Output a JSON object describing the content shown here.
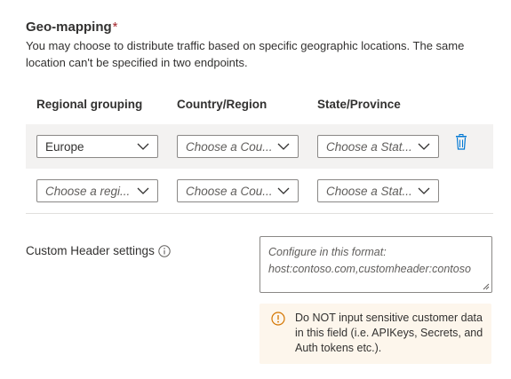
{
  "geo": {
    "title": "Geo-mapping",
    "required_mark": "*",
    "description": "You may choose to distribute traffic based on specific geographic locations. The same location can't be specified in two endpoints."
  },
  "columns": {
    "regional": "Regional grouping",
    "country": "Country/Region",
    "state": "State/Province"
  },
  "rows": [
    {
      "regional": "Europe",
      "country": "Choose a Cou...",
      "state": "Choose a Stat..."
    },
    {
      "regional": "Choose a regi...",
      "country": "Choose a Cou...",
      "state": "Choose a Stat..."
    }
  ],
  "custom_header": {
    "label": "Custom Header settings",
    "placeholder": "Configure in this format:\nhost:contoso.com,customheader:contoso",
    "info_icon": "info-icon"
  },
  "warning": {
    "text": "Do NOT input sensitive customer data in this field (i.e. APIKeys, Secrets, and Auth tokens etc.).",
    "icon": "warning-icon"
  },
  "colors": {
    "accent": "#0078d4",
    "required": "#a4262c",
    "warning_bg": "#fdf6ec",
    "warning_icon": "#d47500"
  }
}
